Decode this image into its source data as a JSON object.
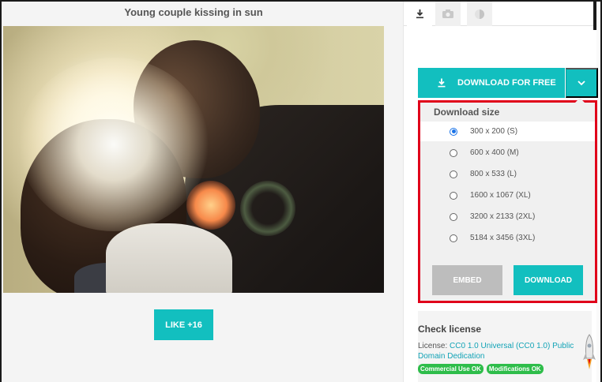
{
  "photo": {
    "title": "Young couple kissing in sun",
    "like_label": "LIKE +16"
  },
  "tabs": [
    {
      "icon": "download-icon",
      "active": true
    },
    {
      "icon": "camera-icon",
      "active": false
    },
    {
      "icon": "contrast-icon",
      "active": false
    }
  ],
  "download": {
    "free_label": "DOWNLOAD FOR FREE",
    "size_title": "Download size",
    "options": [
      {
        "label": "300 x 200 (S)",
        "selected": true
      },
      {
        "label": "600 x 400 (M)",
        "selected": false
      },
      {
        "label": "800 x 533 (L)",
        "selected": false
      },
      {
        "label": "1600 x 1067 (XL)",
        "selected": false
      },
      {
        "label": "3200 x 2133 (2XL)",
        "selected": false
      },
      {
        "label": "5184 x 3456 (3XL)",
        "selected": false
      }
    ],
    "embed_label": "EMBED",
    "download_label": "DOWNLOAD"
  },
  "license": {
    "title": "Check license",
    "prefix": "License: ",
    "link": "CC0 1.0 Universal (CC0 1.0) Public Domain Dedication",
    "badges": [
      "Commercial Use OK",
      "Modifications OK"
    ]
  },
  "colors": {
    "accent": "#12bfbf",
    "highlight_border": "#e0001a",
    "badge_green": "#2ebd4a",
    "radio_selected": "#1a73e8"
  }
}
